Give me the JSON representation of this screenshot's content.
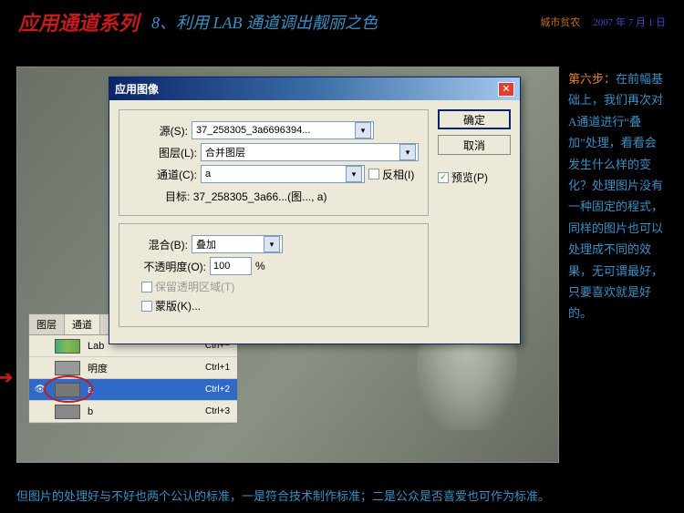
{
  "header": {
    "title_red": "应用通道系列",
    "title_blue": "8、利用 LAB 通道调出靓丽之色",
    "author": "城市贫农",
    "date": "2007 年 7 月 1 日"
  },
  "dialog": {
    "title": "应用图像",
    "source_label": "源(S):",
    "source_value": "37_258305_3a6696394...",
    "layer_label": "图层(L):",
    "layer_value": "合并图层",
    "channel_label": "通道(C):",
    "channel_value": "a",
    "invert_label": "反相(I)",
    "target_label": "目标:",
    "target_value": "37_258305_3a66...(图..., a)",
    "blend_label": "混合(B):",
    "blend_value": "叠加",
    "opacity_label": "不透明度(O):",
    "opacity_value": "100",
    "opacity_pct": "%",
    "preserve_label": "保留透明区域(T)",
    "mask_label": "蒙版(K)...",
    "ok": "确定",
    "cancel": "取消",
    "preview": "预览(P)"
  },
  "channels": {
    "tab_layers": "图层",
    "tab_channels": "通道",
    "rows": [
      {
        "name": "Lab",
        "shortcut": "Ctrl+~"
      },
      {
        "name": "明度",
        "shortcut": "Ctrl+1"
      },
      {
        "name": "a",
        "shortcut": "Ctrl+2"
      },
      {
        "name": "b",
        "shortcut": "Ctrl+3"
      }
    ]
  },
  "sidebar": {
    "step": "第六步：",
    "text": "在前幅基础上，我们再次对A通道进行“叠加”处理，看看会发生什么样的变化？处理图片没有一种固定的程式，同样的图片也可以处理成不同的效果，无可谓最好，只要喜欢就是好的。"
  },
  "footer": "但图片的处理好与不好也两个公认的标准，一是符合技术制作标准；二是公众是否喜爱也可作为标准。"
}
